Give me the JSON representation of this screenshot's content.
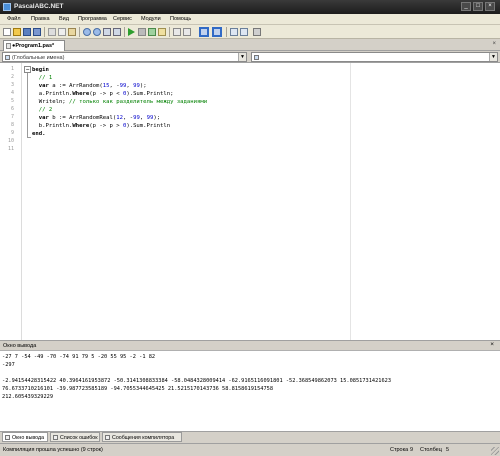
{
  "window": {
    "title": "PascalABC.NET"
  },
  "menu": [
    "Файл",
    "Правка",
    "Вид",
    "Программа",
    "Сервис",
    "Модули",
    "Помощь"
  ],
  "toolbar": {
    "icons": [
      "new-file-icon",
      "open-icon",
      "save-icon",
      "save-all-icon",
      "cut-icon",
      "copy-icon",
      "paste-icon",
      "undo-icon",
      "redo-icon",
      "find-icon",
      "replace-icon",
      "run-icon",
      "stop-icon",
      "compile-icon",
      "debug-icon",
      "step-icon",
      "view-icon-1",
      "view-icon-2",
      "view-icon-3",
      "view-icon-4",
      "form-icon",
      "settings-icon"
    ]
  },
  "tab": {
    "label": "●Program1.pas*",
    "close": "×"
  },
  "selectors": {
    "left": "(Глобальные имена)",
    "right": ""
  },
  "editor": {
    "line_numbers": [
      "1",
      "2",
      "3",
      "4",
      "5",
      "6",
      "7",
      "8",
      "9",
      "10",
      "11"
    ],
    "fold_symbol": "−",
    "lines": [
      [
        {
          "t": "begin",
          "c": "kw"
        }
      ],
      [
        {
          "t": "  // 1",
          "c": "cm"
        }
      ],
      [
        {
          "t": "  "
        },
        {
          "t": "var",
          "c": "kw"
        },
        {
          "t": " a := ArrRandom("
        },
        {
          "t": "15",
          "c": "num"
        },
        {
          "t": ", -"
        },
        {
          "t": "99",
          "c": "num"
        },
        {
          "t": ", "
        },
        {
          "t": "99",
          "c": "num"
        },
        {
          "t": ");"
        }
      ],
      [
        {
          "t": "  a.Println."
        },
        {
          "t": "Where",
          "c": "kw"
        },
        {
          "t": "(p -> p < "
        },
        {
          "t": "0",
          "c": "num"
        },
        {
          "t": ").Sum.Println;"
        }
      ],
      [
        {
          "t": "  Writeln; "
        },
        {
          "t": "// только как разделитель между заданиями",
          "c": "cm"
        }
      ],
      [
        {
          "t": "  // 2",
          "c": "cm"
        }
      ],
      [
        {
          "t": "  "
        },
        {
          "t": "var",
          "c": "kw"
        },
        {
          "t": " b := ArrRandomReal("
        },
        {
          "t": "12",
          "c": "num"
        },
        {
          "t": ", -"
        },
        {
          "t": "99",
          "c": "num"
        },
        {
          "t": ", "
        },
        {
          "t": "99",
          "c": "num"
        },
        {
          "t": ");"
        }
      ],
      [
        {
          "t": "  b.Println."
        },
        {
          "t": "Where",
          "c": "kw"
        },
        {
          "t": "(p -> p > "
        },
        {
          "t": "0",
          "c": "num"
        },
        {
          "t": ").Sum.Println"
        }
      ],
      [
        {
          "t": "end.",
          "c": "kw"
        }
      ],
      [
        {
          "t": ""
        }
      ],
      [
        {
          "t": ""
        }
      ]
    ]
  },
  "output_panel": {
    "title": "Окно вывода",
    "close": "×",
    "lines": [
      "-27 7 -54 -49 -70 -74 91 79 5 -20 55 95 -2 -1 82",
      "-297",
      "",
      "-2.94154428315422 40.3964161953872 -50.3141308833384 -58.0484328009414 -62.9165116091801 -52.368549862073 15.0851731421623",
      "76.6733710216101 -39.987723585189 -94.7055344645425 21.5215170143736 58.8158619154758",
      "212.605439329229"
    ]
  },
  "bottom_tabs": [
    {
      "label": "Окно вывода",
      "active": true
    },
    {
      "label": "Список ошибок",
      "active": false
    },
    {
      "label": "Сообщения компилятора",
      "active": false
    }
  ],
  "status": {
    "message": "Компиляция прошла успешно (9 строк)",
    "row_label": "Строка",
    "row": "9",
    "col_label": "Столбец",
    "col": "5"
  },
  "colors": {
    "keyword": "#000000",
    "comment": "#008000",
    "number": "#0000cc",
    "titlebar": "#2b2b2b"
  }
}
